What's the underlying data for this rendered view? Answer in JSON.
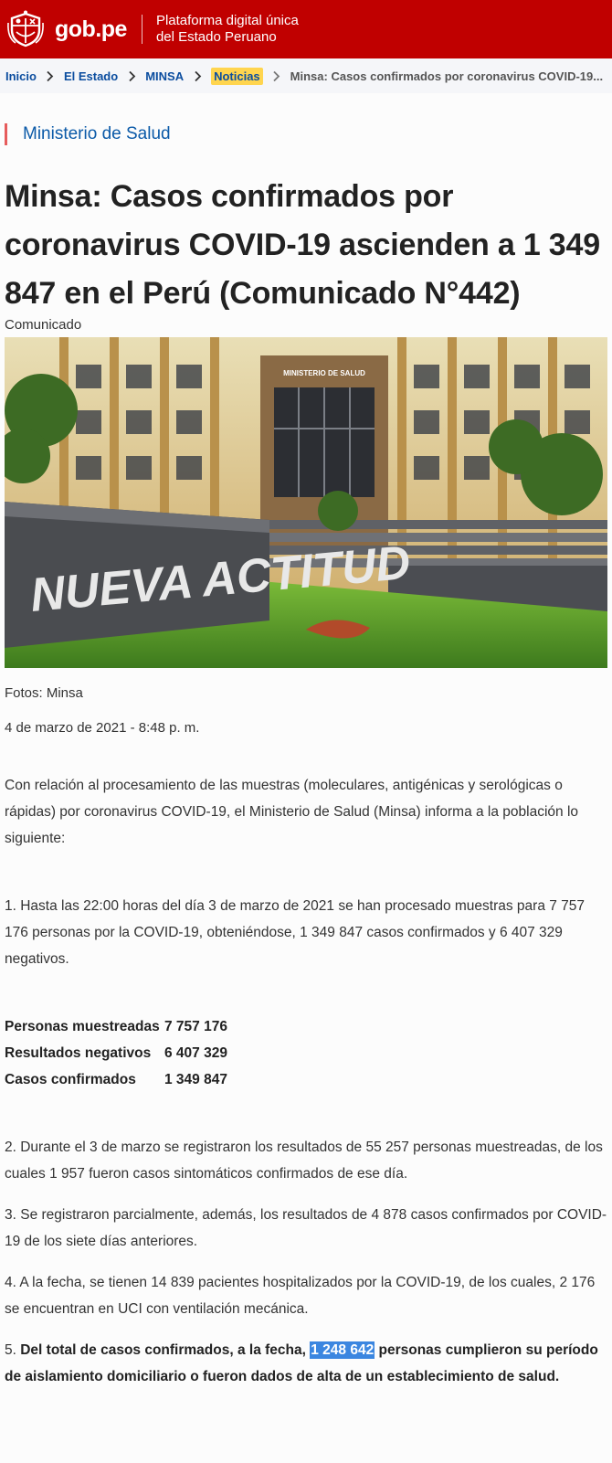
{
  "header": {
    "logo_text": "gob.pe",
    "subtitle_line1": "Plataforma digital única",
    "subtitle_line2": "del Estado Peruano",
    "brand_color": "#c00000"
  },
  "breadcrumb": {
    "items": [
      "Inicio",
      "El Estado",
      "MINSA",
      "Noticias"
    ],
    "current": "Minsa: Casos confirmados por coronavirus COVID-19..."
  },
  "article": {
    "institution": "Ministerio de Salud",
    "title": "Minsa: Casos confirmados por coronavirus COVID-19 ascienden a 1 349 847 en el Perú (Comunicado N°442)",
    "type": "Comunicado",
    "photo_sign": "MINISTERIO DE SALUD",
    "photo_wall_text": "NUEVA ACTITUD",
    "photo_caption": "Fotos: Minsa",
    "date": "4 de marzo de 2021 - 8:48 p. m.",
    "intro": "Con relación al procesamiento de las muestras (moleculares, antigénicas y serológicas o rápidas) por coronavirus COVID-19, el Ministerio de Salud (Minsa) informa a la población lo siguiente:",
    "point1": "1. Hasta las 22:00 horas del día 3 de marzo de 2021 se han procesado muestras para 7 757 176 personas por la COVID-19, obteniéndose, 1 349 847 casos confirmados y 6 407 329 negativos.",
    "stats": [
      {
        "label": "Personas muestreadas",
        "value": "7 757 176"
      },
      {
        "label": "Resultados negativos",
        "value": "6 407 329"
      },
      {
        "label": "Casos confirmados",
        "value": "1 349 847"
      }
    ],
    "point2": "2. Durante el 3 de marzo se registraron los resultados de 55 257 personas muestreadas, de los cuales 1 957 fueron casos sintomáticos confirmados de ese día.",
    "point3": "3. Se registraron parcialmente, además, los resultados de 4 878 casos confirmados por COVID-19 de los siete días anteriores.",
    "point4": "4. A la fecha, se tienen 14 839 pacientes hospitalizados por la COVID-19, de los cuales, 2 176 se encuentran en UCI con ventilación mecánica.",
    "point5_num": "5. ",
    "point5_a": "Del total de casos confirmados, a la fecha, ",
    "point5_sel": "1 248 642",
    "point5_b": " personas cumplieron su período de aislamiento domiciliario o fueron dados de alta de un establecimiento de salud."
  }
}
